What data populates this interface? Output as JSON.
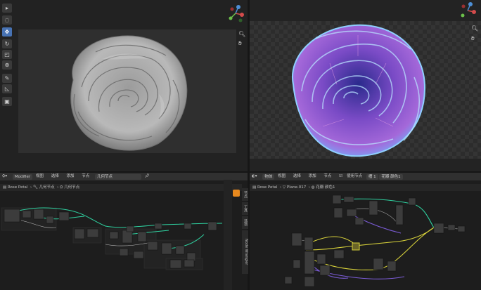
{
  "colors": {
    "accent": "#4772b3",
    "node_link_green": "#2fd1a0",
    "node_link_yellow": "#d7d13a",
    "node_link_purple": "#7b5cd6"
  },
  "viewport_left": {
    "tools": [
      "cursor-icon",
      "select-circle-icon",
      "move-icon",
      "rotate-icon",
      "scale-icon",
      "transform-icon",
      "annotate-icon",
      "measure-icon",
      "add-cube-icon"
    ],
    "nav": [
      "zoom-icon",
      "hand-icon"
    ]
  },
  "viewport_right": {
    "nav": [
      "zoom-icon",
      "hand-icon"
    ]
  },
  "node_left": {
    "editor_type": "Modifier",
    "menu": [
      "视图",
      "选择",
      "添加",
      "节点"
    ],
    "tree_name": "几何节点",
    "breadcrumb": [
      "Rose Petal",
      "几何节点",
      "几何节点"
    ],
    "side_tabs": [
      "节点",
      "工具",
      "选项",
      "Node Wrangler"
    ]
  },
  "node_right": {
    "editor_type": "物体",
    "menu": [
      "视图",
      "选择",
      "添加",
      "节点"
    ],
    "use_nodes_label": "使用节点",
    "slot": "槽 1",
    "material_name": "花瓣 颜色1",
    "breadcrumb": [
      "Rose Petal",
      "Plane.017",
      "花瓣 颜色1"
    ]
  }
}
